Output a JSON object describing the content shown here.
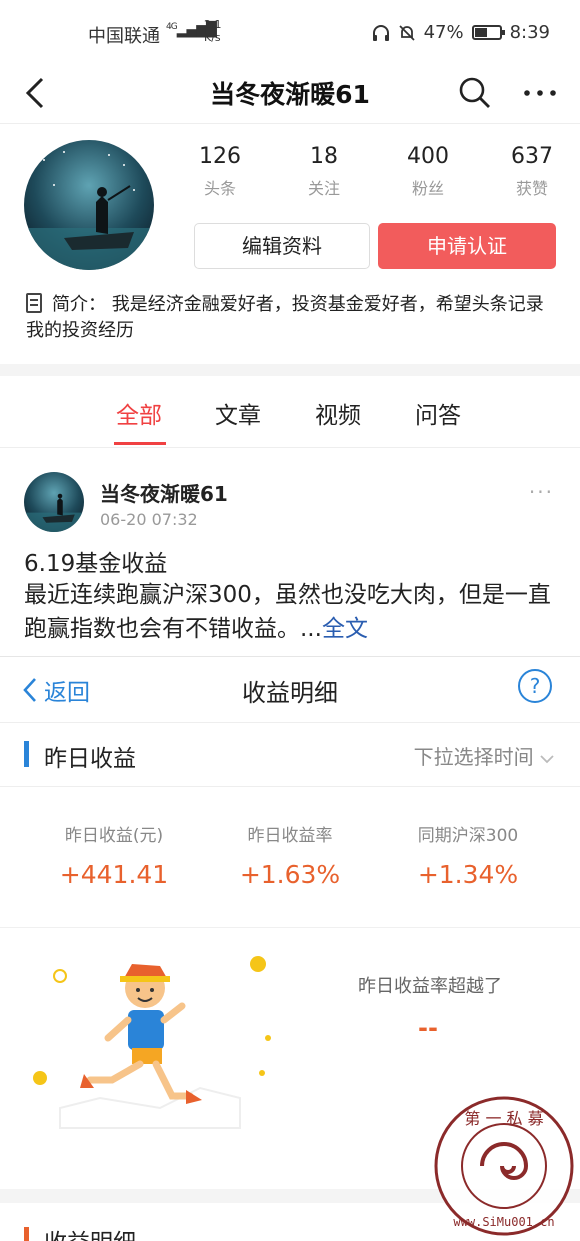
{
  "status_bar": {
    "carrier": "中国联通",
    "network": "4G",
    "speed_value": "2.1",
    "speed_unit": "K/s",
    "battery": "47%",
    "time": "8:39"
  },
  "nav": {
    "title": "当冬夜渐暖61"
  },
  "profile": {
    "stats": [
      {
        "num": "126",
        "label": "头条"
      },
      {
        "num": "18",
        "label": "关注"
      },
      {
        "num": "400",
        "label": "粉丝"
      },
      {
        "num": "637",
        "label": "获赞"
      }
    ],
    "edit_button": "编辑资料",
    "verify_button": "申请认证",
    "bio_label": "简介：",
    "bio_text": "我是经济金融爱好者，投资基金爱好者，希望头条记录我的投资经历"
  },
  "tabs": [
    "全部",
    "文章",
    "视频",
    "问答"
  ],
  "post": {
    "author": "当冬夜渐暖61",
    "time": "06-20 07:32",
    "more": "···",
    "title": "6.19基金收益",
    "body": "最近连续跑赢沪深300，虽然也没吃大肉，但是一直跑赢指数也会有不错收益。...",
    "more_link": "全文"
  },
  "embed": {
    "back_label": "返回",
    "title": "收益明细",
    "help": "?",
    "section_label": "昨日收益",
    "dropdown_label": "下拉选择时间",
    "metrics": [
      {
        "label": "昨日收益(元)",
        "value": "+441.41"
      },
      {
        "label": "昨日收益率",
        "value": "+1.63%"
      },
      {
        "label": "同期沪深300",
        "value": "+1.34%"
      }
    ],
    "exceed_label": "昨日收益率超越了",
    "exceed_value": "--",
    "section2_label": "收益明细"
  },
  "watermark": {
    "chars": "第 一 私 募",
    "url": "www.SiMu001.cn"
  },
  "colors": {
    "accent_red": "#f04142",
    "verify_bg": "#f25c5c",
    "link_blue": "#2a84d8",
    "value_orange": "#e8612d"
  }
}
